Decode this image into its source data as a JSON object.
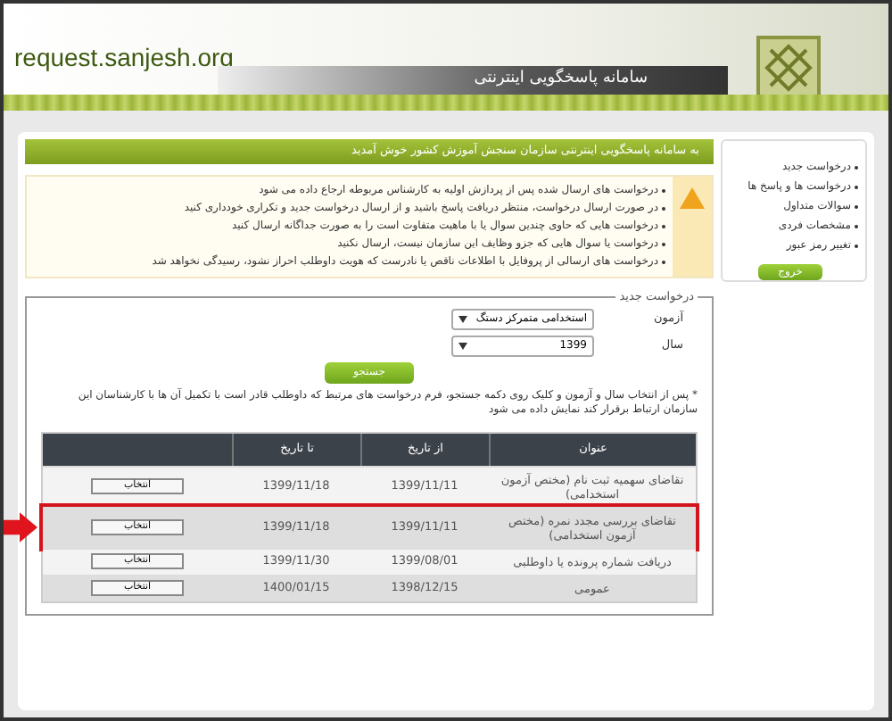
{
  "header": {
    "site": "request.sanjesh.org",
    "title": "سامانه پاسخگویی اینترنتی"
  },
  "welcome": "به سامانه پاسخگویی اینترنتی سازمان سنجش آموزش کشور خوش آمدید",
  "notices": [
    "درخواست های ارسال شده پس از پردازش اولیه به کارشناس مربوطه ارجاع داده می شود",
    "در صورت ارسال درخواست، منتظر دریافت پاسخ باشید و از ارسال درخواست جدید و تکراری خودداری کنید",
    "درخواست هایی که حاوی چندین سوال یا با ماهیت متفاوت است را به صورت جداگانه ارسال کنید",
    "درخواست یا سوال هایی که جزو وظایف این سازمان نیست، ارسال نکنید",
    "درخواست های ارسالی از پروفایل با اطلاعات ناقص یا نادرست که هویت داوطلب احراز نشود، رسیدگی نخواهد شد"
  ],
  "sidebar": {
    "items": [
      "درخواست جدید",
      "درخواست ها و پاسخ ها",
      "سوالات متداول",
      "مشخصات فردی",
      "تغییر رمز عبور"
    ],
    "logout": "خروج"
  },
  "form": {
    "legend": "درخواست جدید",
    "fields": [
      {
        "label": "آزمون",
        "value": "استخدامی متمرکز دستگ"
      },
      {
        "label": "سال",
        "value": "1399"
      }
    ],
    "search": "جستجو",
    "note": "* پس از انتخاب سال و آزمون و کلیک روی دکمه جستجو، فرم درخواست های مرتبط که داوطلب قادر است با تکمیل آن ها با کارشناسان این سازمان ارتباط برقرار کند نمایش داده می شود"
  },
  "table": {
    "columns": [
      "عنوان",
      "از تاریخ",
      "تا تاریخ"
    ],
    "rows": [
      {
        "title": "تقاضای سهمیه ثبت نام (مختص آزمون استخدامی)",
        "from": "1399/11/11",
        "to": "1399/11/18",
        "action": "انتخاب",
        "selected": false
      },
      {
        "title": "تقاضای بررسی مجدد نمره (مختص آزمون استخدامی)",
        "from": "1399/11/11",
        "to": "1399/11/18",
        "action": "انتخاب",
        "selected": true
      },
      {
        "title": "دریافت شماره پرونده یا داوطلبی",
        "from": "1399/08/01",
        "to": "1399/11/30",
        "action": "انتخاب",
        "selected": false
      },
      {
        "title": "عمومی",
        "from": "1398/12/15",
        "to": "1400/01/15",
        "action": "انتخاب",
        "selected": false
      }
    ]
  }
}
